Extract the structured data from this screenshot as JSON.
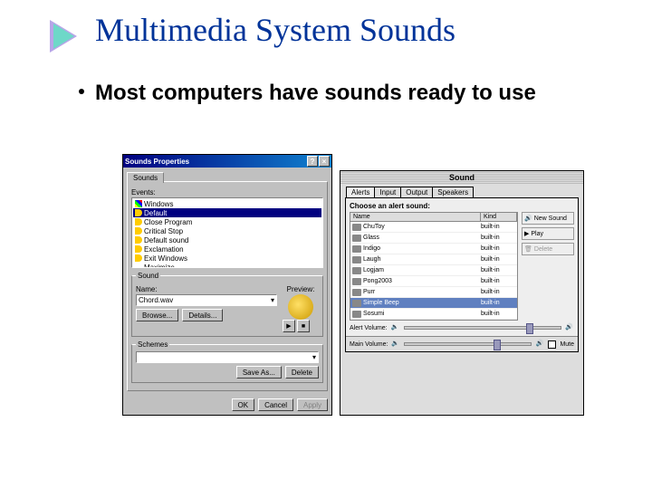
{
  "title": "Multimedia System Sounds",
  "bullet": "Most computers have sounds ready to use",
  "win": {
    "titlebar": "Sounds Properties",
    "tab": "Sounds",
    "events_label": "Events:",
    "items": [
      {
        "label": "Windows",
        "icon": "win"
      },
      {
        "label": "Default",
        "icon": "snd",
        "sel": true
      },
      {
        "label": "Close Program",
        "icon": "snd"
      },
      {
        "label": "Critical Stop",
        "icon": "snd"
      },
      {
        "label": "Default sound",
        "icon": "snd"
      },
      {
        "label": "Exclamation",
        "icon": "snd"
      },
      {
        "label": "Exit Windows",
        "icon": "snd"
      },
      {
        "label": "Maximize",
        "icon": ""
      }
    ],
    "sound_legend": "Sound",
    "name_label": "Name:",
    "name_value": "Chord.wav",
    "browse": "Browse...",
    "details": "Details...",
    "preview": "Preview:",
    "schemes_legend": "Schemes",
    "saveas": "Save As...",
    "delete": "Delete",
    "ok": "OK",
    "cancel": "Cancel",
    "apply": "Apply"
  },
  "mac": {
    "title": "Sound",
    "tabs": [
      "Alerts",
      "Input",
      "Output",
      "Speakers"
    ],
    "choose": "Choose an alert sound:",
    "cols": {
      "name": "Name",
      "kind": "Kind"
    },
    "rows": [
      {
        "name": "ChuToy",
        "kind": "built-in"
      },
      {
        "name": "Glass",
        "kind": "built-in"
      },
      {
        "name": "Indigo",
        "kind": "built-in"
      },
      {
        "name": "Laugh",
        "kind": "built-in"
      },
      {
        "name": "Logjam",
        "kind": "built-in"
      },
      {
        "name": "Pong2003",
        "kind": "built-in"
      },
      {
        "name": "Purr",
        "kind": "built-in"
      },
      {
        "name": "Simple Beep",
        "kind": "built-in",
        "sel": true
      },
      {
        "name": "Sosumi",
        "kind": "built-in"
      }
    ],
    "btns": {
      "new": "New Sound",
      "play": "Play",
      "delete": "Delete"
    },
    "alert_vol": "Alert Volume:",
    "main_vol": "Main Volume:",
    "mute": "Mute"
  }
}
